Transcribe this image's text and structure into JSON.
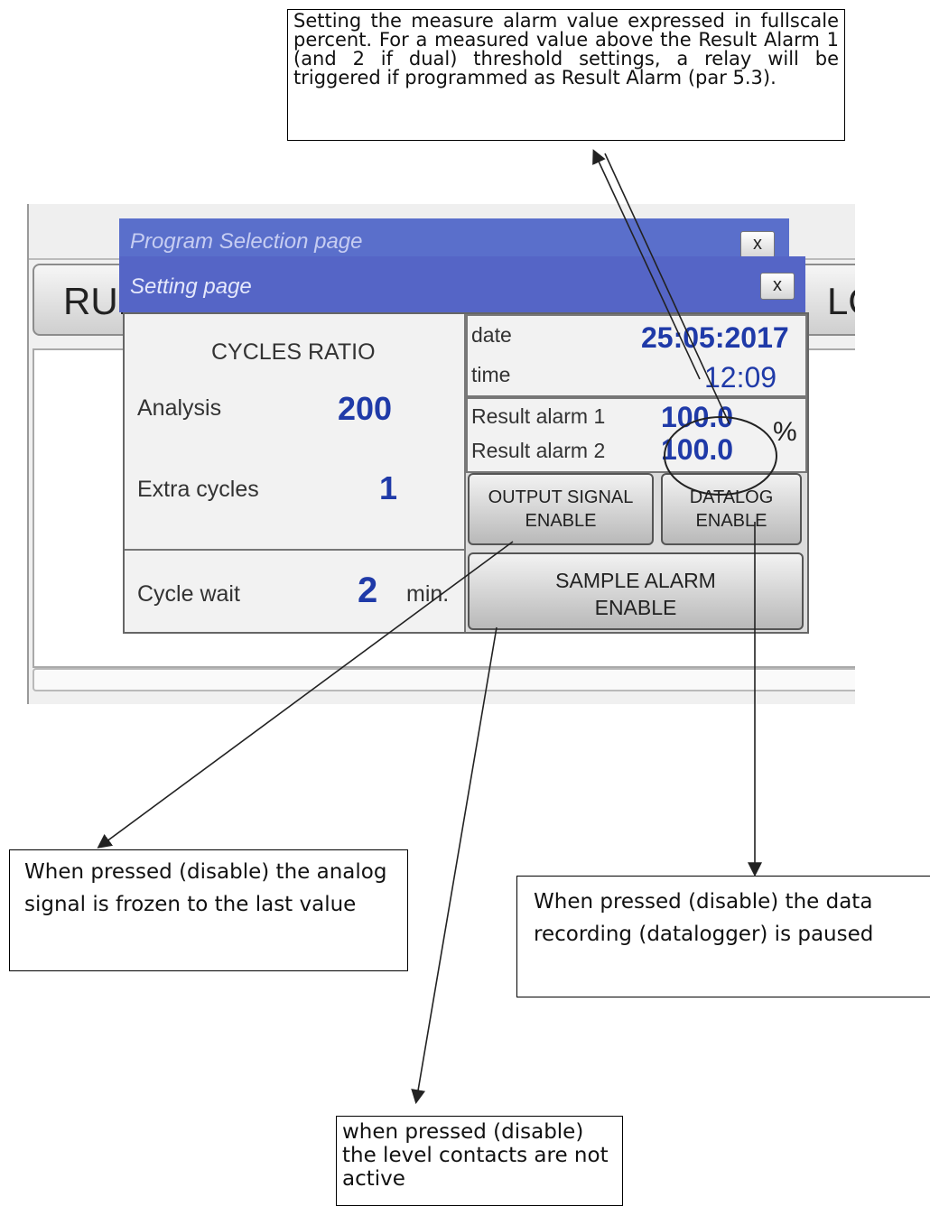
{
  "callouts": {
    "top": "Setting the measure alarm value expressed in fullscale percent. For a measured value above the Result Alarm 1 (and 2 if dual) threshold settings,    a relay will be triggered if programmed as Result Alarm (par 5.3).",
    "output_signal": "When pressed (disable) the analog signal  is  frozen to the last value",
    "datalog": "When pressed (disable) the data recording (datalogger) is paused",
    "sample_alarm": "when pressed (disable) the level contacts are not active"
  },
  "background": {
    "run_button": "RUN",
    "log_button_fragment": "LO"
  },
  "windows": {
    "program_selection_title": "Program Selection page",
    "setting_title": "Setting page",
    "close_label": "x"
  },
  "setting": {
    "cycles_ratio_label": "CYCLES RATIO",
    "analysis_label": "Analysis",
    "analysis_value": "200",
    "extra_cycles_label": "Extra cycles",
    "extra_cycles_value": "1",
    "cycle_wait_label": "Cycle wait",
    "cycle_wait_value": "2",
    "cycle_wait_unit": "min.",
    "date_label": "date",
    "date_value": "25:05:2017",
    "time_label": "time",
    "time_value": "12:09",
    "result_alarm_1_label": "Result alarm 1",
    "result_alarm_1_value": "100.0",
    "result_alarm_2_label": "Result alarm 2",
    "result_alarm_2_value": "100.0",
    "percent_unit": "%",
    "output_signal_button": [
      "OUTPUT SIGNAL",
      "ENABLE"
    ],
    "datalog_button": [
      "DATALOG",
      "ENABLE"
    ],
    "sample_alarm_button": [
      "SAMPLE ALARM",
      "ENABLE"
    ]
  }
}
